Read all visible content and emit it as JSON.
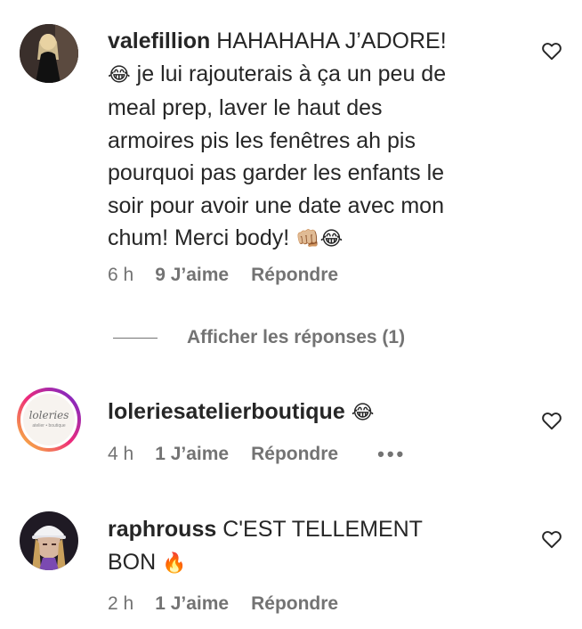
{
  "comments": [
    {
      "username": "valefillion",
      "text": " HAHAHAHA J’ADORE!",
      "text2": " je lui rajouterais à ça un peu de\nmeal prep, laver le haut des\narmoires pis les fenêtres ah pis\npourquoi pas garder les enfants le\nsoir pour avoir une date avec mon\nchum! Merci body! ",
      "emoji_1": "😂",
      "emoji_2": "👊🏼😂",
      "time": "6 h",
      "likes": "9 J’aime",
      "reply": "Répondre",
      "avatar": "user-photo-dark"
    },
    {
      "username": "loleriesatelierboutique",
      "text": " ",
      "emoji_1": "😂",
      "time": "4 h",
      "likes": "1 J’aime",
      "reply": "Répondre",
      "more": "•••",
      "avatar_text": "loleries",
      "avatar_subtext": "atelier • boutique"
    },
    {
      "username": "raphrouss",
      "text": " C'EST TELLEMENT\nBON ",
      "emoji_1": "🔥",
      "time": "2 h",
      "likes": "1 J’aime",
      "reply": "Répondre",
      "avatar": "user-photo-cap"
    }
  ],
  "replies_toggle": {
    "label": "Afficher les réponses (1)"
  },
  "colors": {
    "text": "#262626",
    "secondary": "#737373",
    "story_ring_start": "#f9ce34",
    "story_ring_mid": "#ee2a7b",
    "story_ring_end": "#6228d7"
  }
}
